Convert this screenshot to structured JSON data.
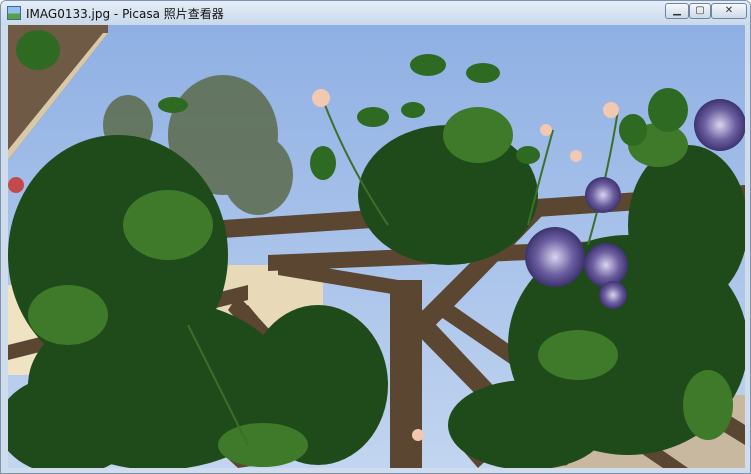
{
  "window": {
    "title": "IMAG0133.jpg - Picasa 照片查看器",
    "controls": {
      "minimize_icon": "minimize-icon",
      "maximize_icon": "maximize-icon",
      "close_icon": "close-icon"
    }
  },
  "photo": {
    "subject": "climbing roses and clematis on a wooden trellis pergola under blue sky"
  },
  "colors": {
    "sky": "#a9c4ec",
    "foliage": "#1f4a1a",
    "trellis": "#5b4632",
    "clematis": "#5b4f88"
  }
}
